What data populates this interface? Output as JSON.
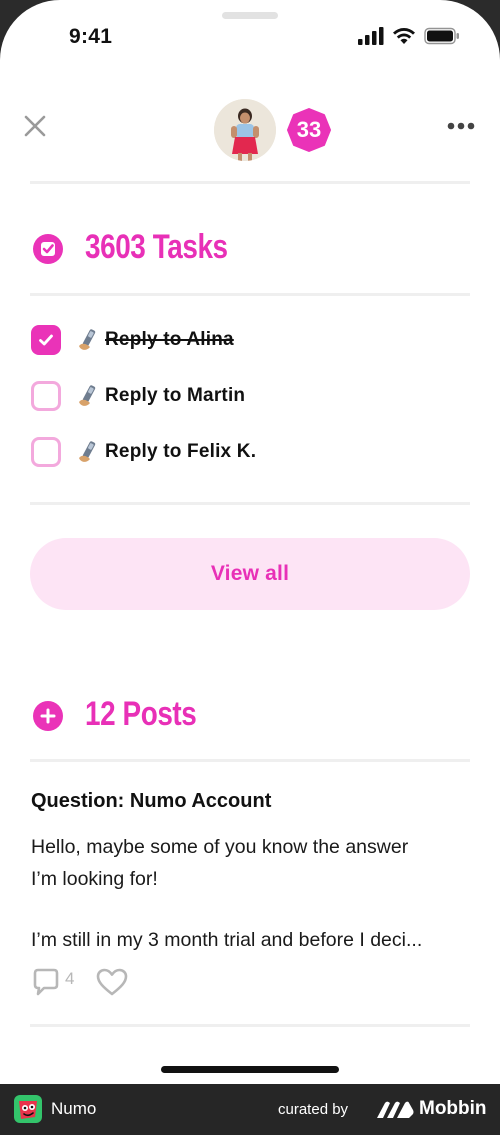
{
  "status_bar": {
    "time": "9:41"
  },
  "header": {
    "badge_count": "33"
  },
  "tasks": {
    "title": "3603 Tasks",
    "items": [
      {
        "label": "Reply to Alina",
        "done": true
      },
      {
        "label": "Reply to Martin",
        "done": false
      },
      {
        "label": "Reply to Felix K.",
        "done": false
      }
    ],
    "view_all_label": "View all"
  },
  "posts": {
    "title": "12 Posts",
    "post": {
      "title": "Question: Numo Account",
      "body_line1": "Hello, maybe some of you know the answer",
      "body_line2": "I’m looking for!",
      "body_line3": "I’m still in my 3 month trial and before I deci...",
      "comment_count": "4"
    }
  },
  "footer": {
    "app_name": "Numo",
    "curated_by": "curated by",
    "brand": "Mobbin"
  },
  "colors": {
    "accent": "#e830b7",
    "accent_light": "#fde4f5",
    "checkbox_border": "#f3a9dd"
  }
}
